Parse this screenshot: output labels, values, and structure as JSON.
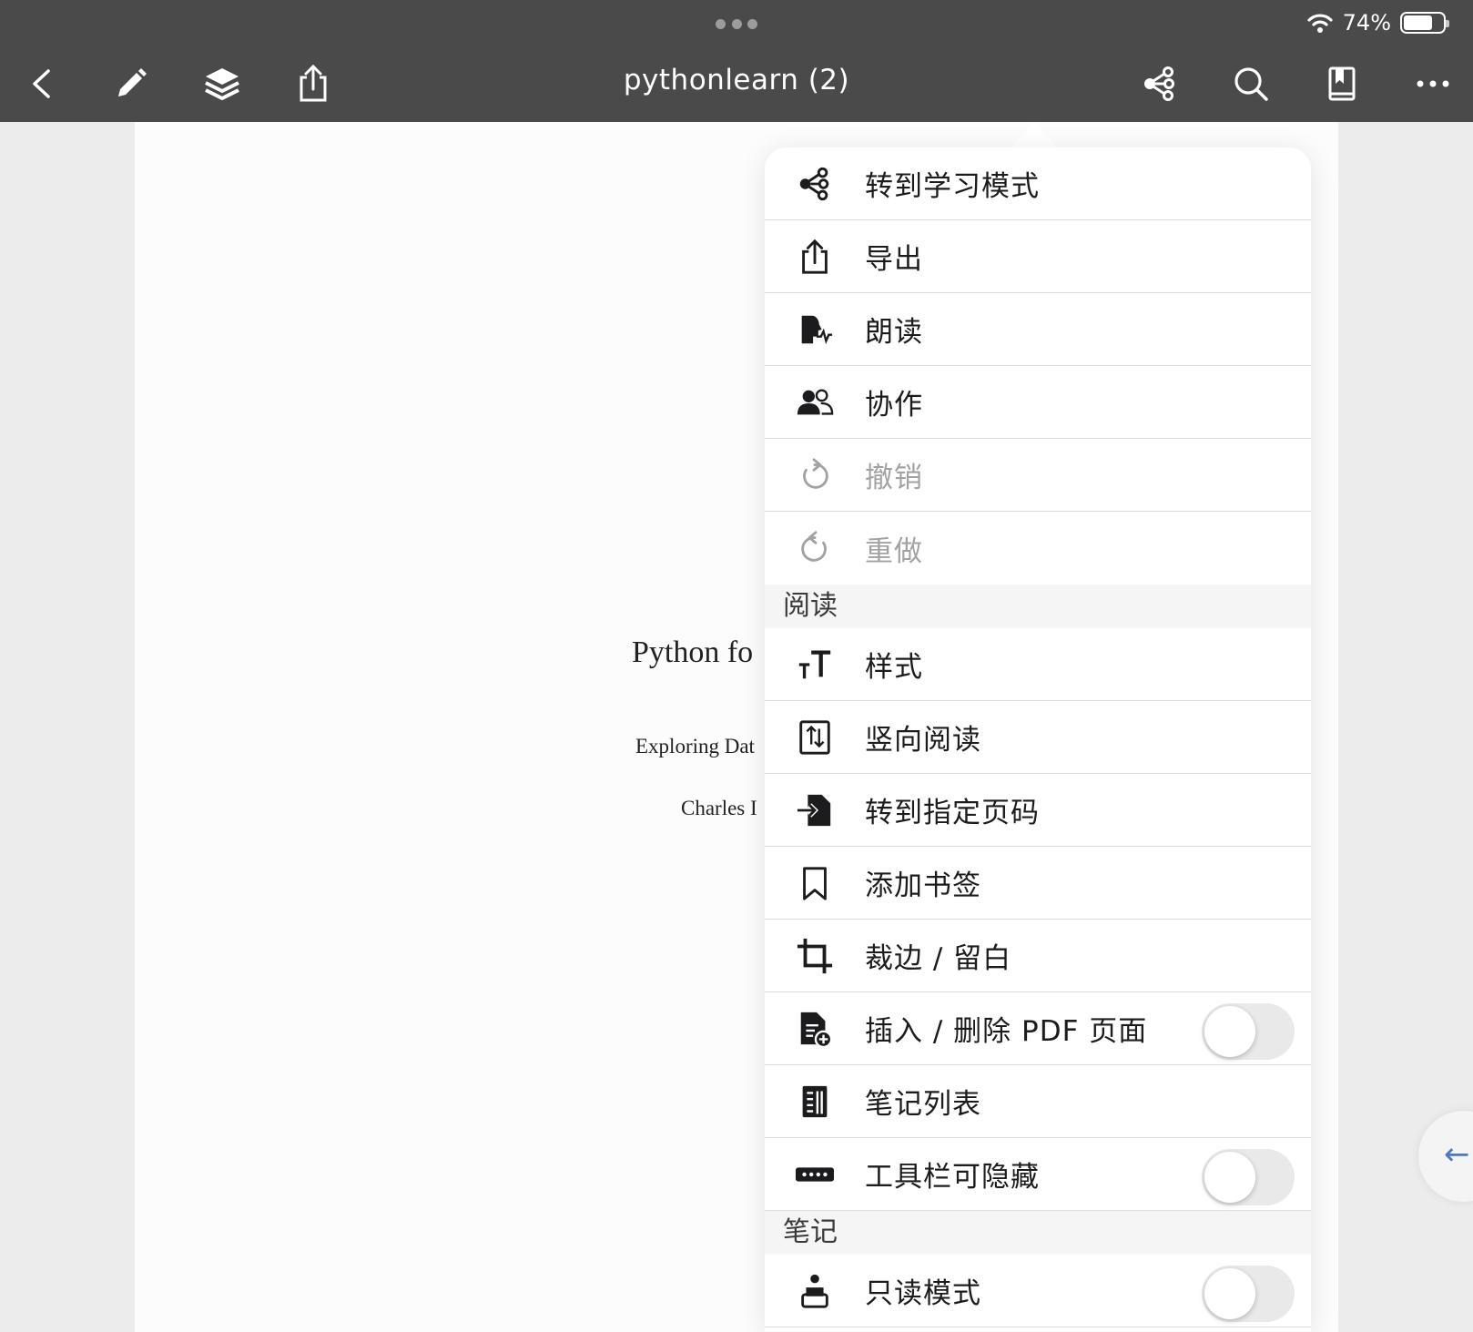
{
  "status_bar": {
    "battery_percent": "74%",
    "battery_level": 0.74
  },
  "toolbar": {
    "document_title": "pythonlearn (2)"
  },
  "document": {
    "title_fragment": "Python fo",
    "subtitle_fragment": "Exploring Dat",
    "author_fragment": "Charles I"
  },
  "menu": {
    "top_items": [
      {
        "label": "转到学习模式",
        "icon": "mindmap-icon",
        "enabled": true
      },
      {
        "label": "导出",
        "icon": "export-icon",
        "enabled": true
      },
      {
        "label": "朗读",
        "icon": "read-aloud-icon",
        "enabled": true
      },
      {
        "label": "协作",
        "icon": "collaborate-icon",
        "enabled": true
      },
      {
        "label": "撤销",
        "icon": "undo-icon",
        "enabled": false
      },
      {
        "label": "重做",
        "icon": "redo-icon",
        "enabled": false
      }
    ],
    "section_reading": "阅读",
    "reading_items": [
      {
        "label": "样式",
        "icon": "text-style-icon"
      },
      {
        "label": "竖向阅读",
        "icon": "vertical-scroll-icon"
      },
      {
        "label": "转到指定页码",
        "icon": "go-to-page-icon"
      },
      {
        "label": "添加书签",
        "icon": "bookmark-icon"
      },
      {
        "label": "裁边 / 留白",
        "icon": "crop-icon"
      },
      {
        "label": "插入 / 删除 PDF 页面",
        "icon": "pdf-add-page-icon",
        "toggle": false
      },
      {
        "label": "笔记列表",
        "icon": "notes-list-icon"
      },
      {
        "label": "工具栏可隐藏",
        "icon": "toolbar-icon",
        "toggle": false
      }
    ],
    "section_notes": "笔记",
    "notes_items": [
      {
        "label": "只读模式",
        "icon": "read-only-icon",
        "toggle": false
      }
    ]
  },
  "edge_button": {
    "icon": "left-arrow-icon",
    "glyph": "←"
  },
  "colors": {
    "toolbar_bg": "#4a4a4a",
    "accent_blue": "#4a78c8",
    "disabled_text": "#a2a2a2",
    "toggle_off": "#e9e9ea"
  }
}
